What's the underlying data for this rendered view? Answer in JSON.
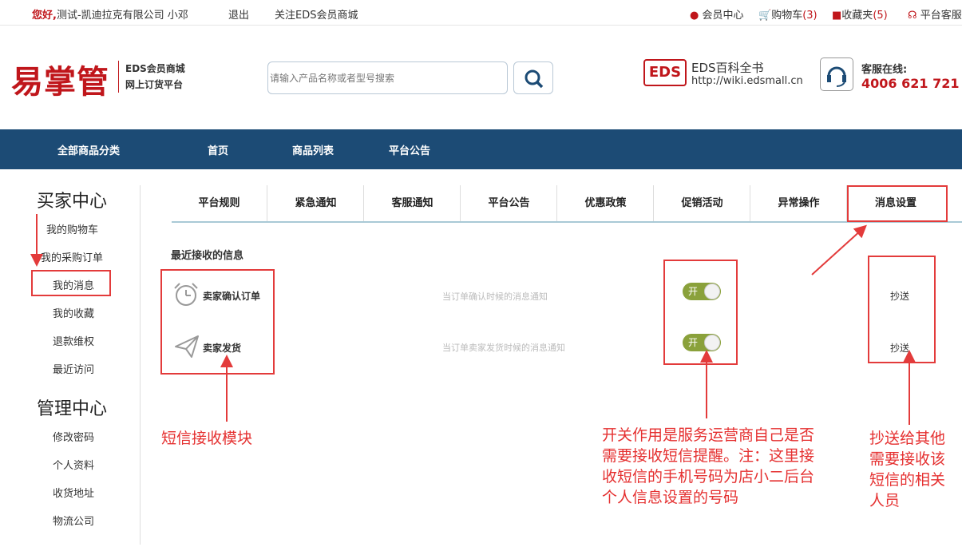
{
  "topbar": {
    "greeting": "您好,",
    "user": "测试-凯迪拉克有限公司 小邓",
    "logout": "退出",
    "follow": "关注EDS会员商城",
    "member_center": "会员中心",
    "cart": "购物车",
    "cart_count": "(3)",
    "favorites": "收藏夹",
    "fav_count": "(5)",
    "service": "平台客服"
  },
  "header": {
    "logo": "易掌管",
    "logo_line1": "EDS会员商城",
    "logo_line2": "网上订货平台",
    "search_placeholder": "请输入产品名称或者型号搜索",
    "wiki_title": "EDS百科全书",
    "wiki_url": "http://wiki.edsmall.cn",
    "cs_label": "客服在线:",
    "cs_phone": "4006 621 721",
    "eds_badge": "EDS"
  },
  "nav": {
    "items": [
      "全部商品分类",
      "首页",
      "商品列表",
      "平台公告"
    ]
  },
  "sidebar": {
    "buyer_title": "买家中心",
    "buyer_items": [
      "我的购物车",
      "我的采购订单",
      "我的消息",
      "我的收藏",
      "退款维权",
      "最近访问"
    ],
    "admin_title": "管理中心",
    "admin_items": [
      "修改密码",
      "个人资料",
      "收货地址",
      "物流公司"
    ]
  },
  "tabs": [
    "平台规则",
    "紧急通知",
    "客服通知",
    "平台公告",
    "优惠政策",
    "促销活动",
    "异常操作",
    "消息设置"
  ],
  "main": {
    "section_title": "最近接收的信息",
    "rows": [
      {
        "name": "卖家确认订单",
        "desc": "当订单确认时候的消息通知",
        "toggle": "开",
        "cc": "抄送"
      },
      {
        "name": "卖家发货",
        "desc": "当订单卖家发货时候的消息通知",
        "toggle": "开",
        "cc": "抄送"
      }
    ]
  },
  "annotations": {
    "sms_module": "短信接收模块",
    "switch_note": [
      "开关作用是服务运营商自己是否",
      "需要接收短信提醒。注：这里接",
      "收短信的手机号码为店小二后台",
      "个人信息设置的号码"
    ],
    "cc_note": [
      "抄送给其他",
      "需要接收该",
      "短信的相关",
      "人员"
    ]
  },
  "colors": {
    "accent_red": "#c0161b",
    "nav_blue": "#1c4b75",
    "toggle_green": "#8aa13b",
    "annotation_red": "#e53030"
  }
}
